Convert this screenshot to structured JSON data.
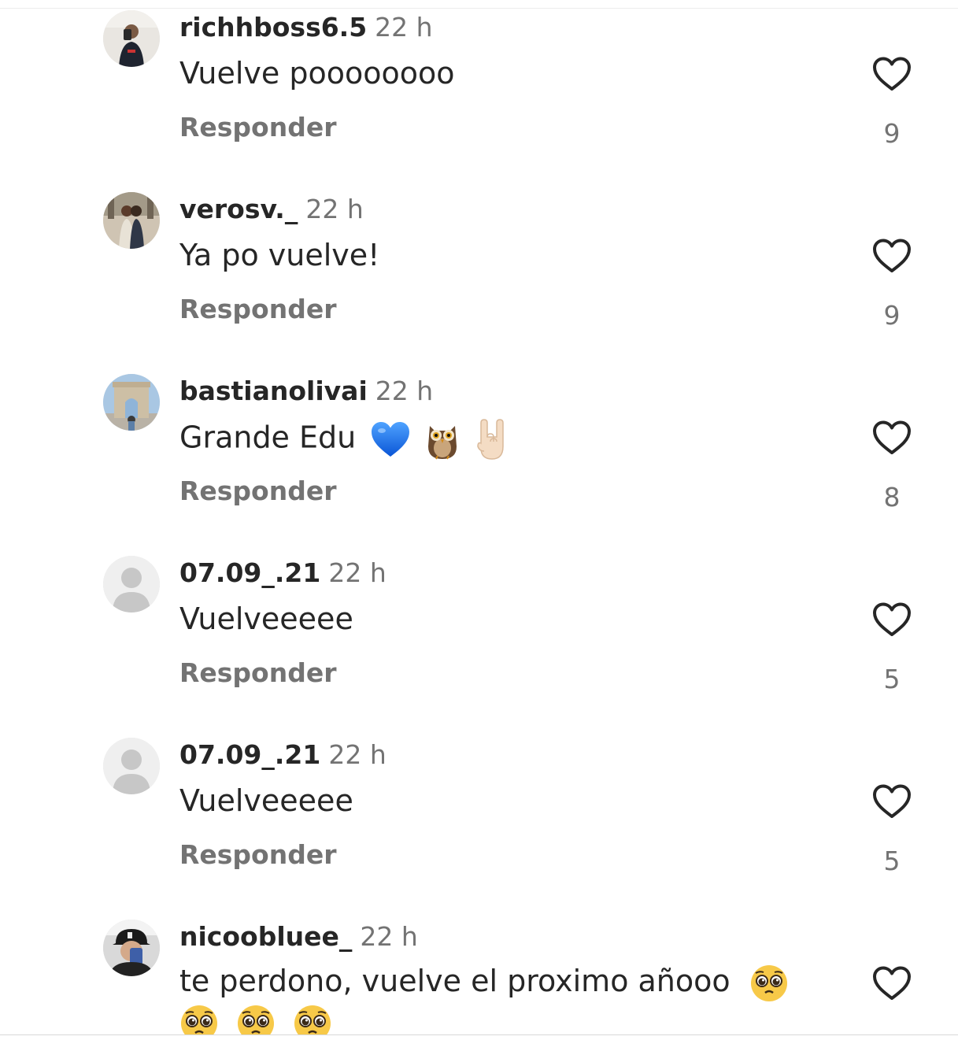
{
  "comments": [
    {
      "username": "richhboss6.5",
      "time": "22 h",
      "text": "Vuelve poooooooo",
      "emojis": [],
      "reply": "Responder",
      "likes": "9",
      "avatar": "photo-person"
    },
    {
      "username": "verosv._",
      "time": "22 h",
      "text": "Ya po vuelve!",
      "emojis": [],
      "reply": "Responder",
      "likes": "9",
      "avatar": "photo-couple"
    },
    {
      "username": "bastianolivai",
      "time": "22 h",
      "text": "Grande Edu",
      "emojis": [
        "blue-heart",
        "owl",
        "rock-on-hand"
      ],
      "reply": "Responder",
      "likes": "8",
      "avatar": "photo-arc"
    },
    {
      "username": "07.09_.21",
      "time": "22 h",
      "text": "Vuelveeeee",
      "emojis": [],
      "reply": "Responder",
      "likes": "5",
      "avatar": "default"
    },
    {
      "username": "07.09_.21",
      "time": "22 h",
      "text": "Vuelveeeee",
      "emojis": [],
      "reply": "Responder",
      "likes": "5",
      "avatar": "default"
    },
    {
      "username": "nicoobluee_",
      "time": "22 h",
      "text": "te perdono, vuelve el proximo añooo",
      "emojis": [
        "pleading-face",
        "pleading-face",
        "pleading-face",
        "pleading-face"
      ],
      "reply": "",
      "likes": "",
      "avatar": "photo-cap"
    }
  ],
  "colors": {
    "primary_text": "#262626",
    "secondary_text": "#737373",
    "avatar_placeholder": "#c7c7c7"
  }
}
